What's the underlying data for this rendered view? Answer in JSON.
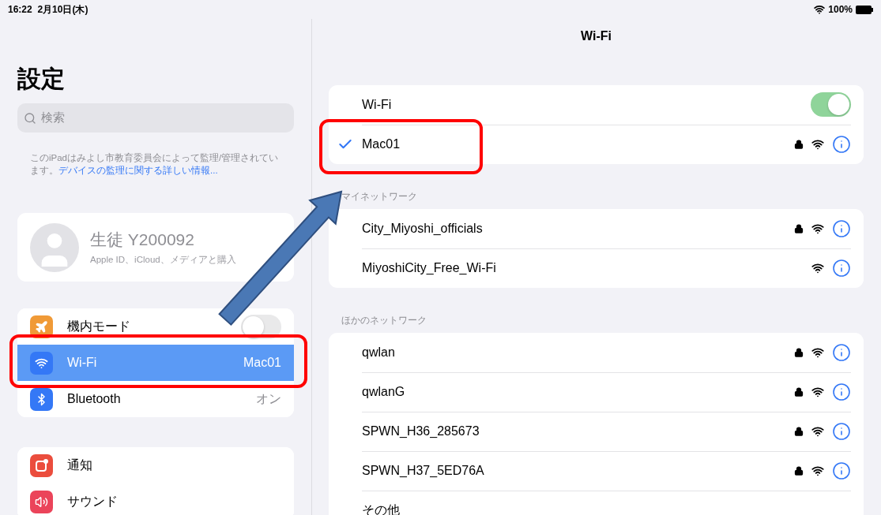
{
  "status_bar": {
    "time": "16:22",
    "date": "2月10日(木)",
    "battery": "100%"
  },
  "sidebar": {
    "title": "設定",
    "search": {
      "placeholder": "検索"
    },
    "notice": {
      "text": "このiPadはみよし市教育委員会によって監理/管理されています。",
      "link": "デバイスの監理に関する詳しい情報..."
    },
    "profile": {
      "name": "生徒 Y200092",
      "subtitle": "Apple ID、iCloud、メディアと購入"
    },
    "groups": [
      [
        {
          "kind": "toggle",
          "label": "機内モード",
          "on": false,
          "selected": false,
          "color": "#f09a37"
        },
        {
          "kind": "value",
          "label": "Wi-Fi",
          "value": "Mac01",
          "selected": true,
          "color": "#3478f6"
        },
        {
          "kind": "value",
          "label": "Bluetooth",
          "value": "オン",
          "selected": false,
          "color": "#3478f6"
        }
      ],
      [
        {
          "kind": "plain",
          "label": "通知",
          "selected": false,
          "color": "#eb4d3d"
        },
        {
          "kind": "plain",
          "label": "サウンド",
          "selected": false,
          "color": "#eb445a"
        }
      ]
    ]
  },
  "detail": {
    "title": "Wi-Fi",
    "wifi_toggle": {
      "label": "Wi-Fi",
      "on": true
    },
    "current": {
      "name": "Mac01",
      "selected": true,
      "lock": true
    },
    "sections": [
      {
        "header": "マイネットワーク",
        "networks": [
          {
            "name": "City_Miyoshi_officials",
            "lock": true
          },
          {
            "name": "MiyoshiCity_Free_Wi-Fi",
            "lock": false
          }
        ]
      },
      {
        "header": "ほかのネットワーク",
        "networks": [
          {
            "name": "qwlan",
            "lock": true
          },
          {
            "name": "qwlanG",
            "lock": true
          },
          {
            "name": "SPWN_H36_285673",
            "lock": true
          },
          {
            "name": "SPWN_H37_5ED76A",
            "lock": true
          }
        ],
        "other": "その他"
      }
    ]
  }
}
